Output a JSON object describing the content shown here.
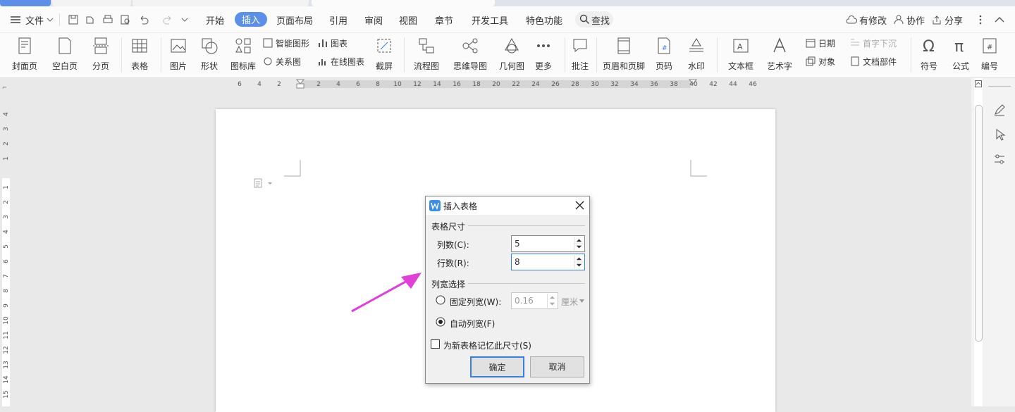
{
  "menu": {
    "file": "文件",
    "tabs": [
      "开始",
      "插入",
      "页面布局",
      "引用",
      "审阅",
      "视图",
      "章节",
      "开发工具",
      "特色功能"
    ],
    "search": "查找",
    "modified": "有修改",
    "collab": "协作",
    "share": "分享"
  },
  "ribbon": {
    "cover": "封面页",
    "blank": "空白页",
    "pagebreak": "分页",
    "table": "表格",
    "picture": "图片",
    "shape": "形状",
    "iconlib": "图标库",
    "smartart": "智能图形",
    "relation": "关系图",
    "chart": "图表",
    "onlinechart": "在线图表",
    "screenshot": "截屏",
    "flowchart": "流程图",
    "mindmap": "思维导图",
    "geometry": "几何图",
    "more": "更多",
    "comment": "批注",
    "headerfooter": "页眉和页脚",
    "pagenum": "页码",
    "watermark": "水印",
    "textbox": "文本框",
    "wordart": "艺术字",
    "date": "日期",
    "object": "对象",
    "dropcap": "首字下沉",
    "docpart": "文档部件",
    "symbol": "符号",
    "formula": "公式",
    "numbering": "编号"
  },
  "ruler_h": [
    "6",
    "4",
    "2",
    "",
    "2",
    "4",
    "6",
    "8",
    "10",
    "12",
    "14",
    "16",
    "18",
    "20",
    "22",
    "24",
    "26",
    "28",
    "30",
    "32",
    "34",
    "36",
    "38",
    "40",
    "42",
    "44",
    "46"
  ],
  "ruler_v": [
    "4",
    "3",
    "2",
    "1",
    "",
    "1",
    "2",
    "3",
    "4",
    "5",
    "6",
    "7",
    "8",
    "9",
    "10",
    "11",
    "12",
    "13",
    "14",
    "15"
  ],
  "dialog": {
    "title": "插入表格",
    "size_group": "表格尺寸",
    "cols_label": "列数(C):",
    "cols_value": "5",
    "rows_label": "行数(R):",
    "rows_value": "8",
    "width_group": "列宽选择",
    "fixed_label": "固定列宽(W):",
    "fixed_value": "0.16",
    "unit": "厘米",
    "auto_label": "自动列宽(F)",
    "remember_label": "为新表格记忆此尺寸(S)",
    "ok": "确定",
    "cancel": "取消"
  },
  "colors": {
    "accent": "#5b8fe8",
    "arrow": "#e040d8",
    "dialog_icon": "#3a8ee6"
  }
}
